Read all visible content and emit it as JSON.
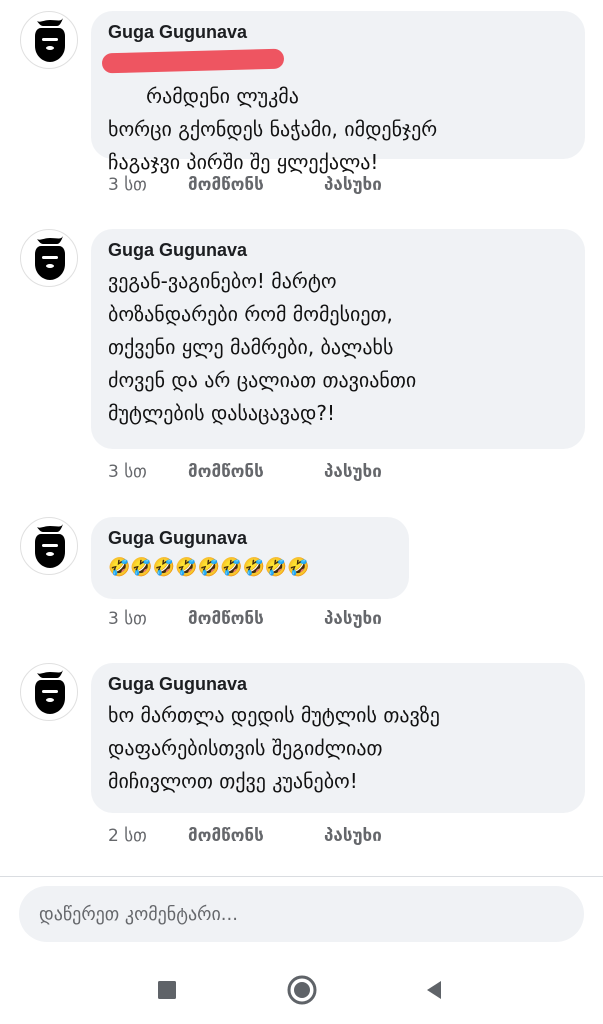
{
  "comments": [
    {
      "author": "Guga Gugunava",
      "text": "რამდენი ლუკმა\nხორცი გქონდეს ნაჭამი, იმდენჯერ\nჩაგაჯვი პირში შე ყლექალა!",
      "time": "3 სთ",
      "like": "მომწონს",
      "reply": "პასუხი"
    },
    {
      "author": "Guga Gugunava",
      "text": "ვეგან-ვაგინებო! მარტო\nბოზანდარები რომ მომესიეთ,\nთქვენი ყლე მამრები, ბალახს\nძოვენ და არ ცალიათ თავიანთი\nმუტლების დასაცავად?!",
      "time": "3 სთ",
      "like": "მომწონს",
      "reply": "პასუხი"
    },
    {
      "author": "Guga Gugunava",
      "text": "🤣🤣🤣🤣🤣🤣🤣🤣🤣",
      "time": "3 სთ",
      "like": "მომწონს",
      "reply": "პასუხი"
    },
    {
      "author": "Guga Gugunava",
      "text": "ხო მართლა დედის მუტლის თავზე\nდაფარებისთვის შეგიძლიათ\nმიჩივლოთ თქვე კუანებო!",
      "time": "2 სთ",
      "like": "მომწონს",
      "reply": "პასუხი"
    }
  ],
  "composer": {
    "placeholder": "დაწერეთ კომენტარი..."
  },
  "navbar": {
    "icons": [
      "stop-square-icon",
      "home-circle-icon",
      "back-triangle-icon"
    ],
    "color": "#5f6368"
  },
  "colors": {
    "bubble": "#f0f2f5",
    "meta_text": "#65676b",
    "redaction": "#ee5561"
  }
}
